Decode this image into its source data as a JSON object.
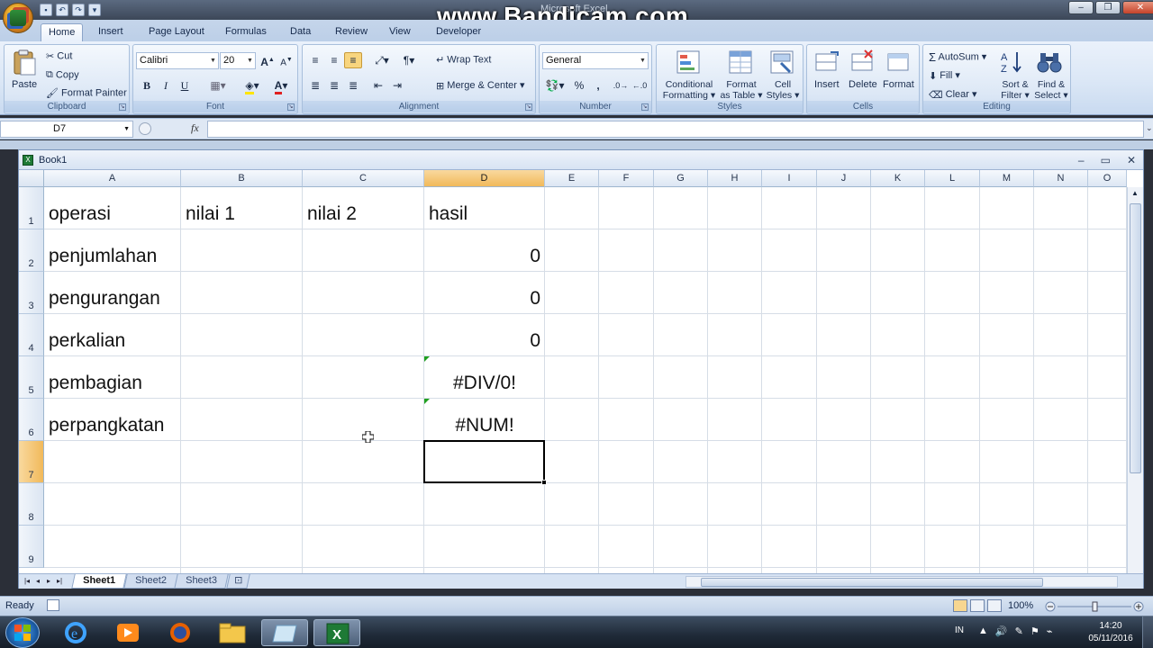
{
  "window": {
    "title": "Microsoft Excel",
    "watermark": "www.Bandicam.com"
  },
  "ribbon": {
    "tabs": [
      "Home",
      "Insert",
      "Page Layout",
      "Formulas",
      "Data",
      "Review",
      "View",
      "Developer"
    ],
    "active_tab": "Home",
    "clipboard": {
      "label": "Clipboard",
      "paste": "Paste",
      "cut": "Cut",
      "copy": "Copy",
      "format_painter": "Format Painter"
    },
    "font": {
      "label": "Font",
      "name": "Calibri",
      "size": "20",
      "bold": "B",
      "italic": "I",
      "underline": "U"
    },
    "alignment": {
      "label": "Alignment",
      "wrap_text": "Wrap Text",
      "merge_center": "Merge & Center"
    },
    "number": {
      "label": "Number",
      "format": "General",
      "percent": "%",
      "comma": ","
    },
    "styles": {
      "label": "Styles",
      "conditional": "Conditional",
      "conditional2": "Formatting",
      "format_table": "Format",
      "format_table2": "as Table",
      "cell_styles": "Cell",
      "cell_styles2": "Styles"
    },
    "cells": {
      "label": "Cells",
      "insert": "Insert",
      "delete": "Delete",
      "format": "Format"
    },
    "editing": {
      "label": "Editing",
      "autosum": "AutoSum",
      "fill": "Fill",
      "clear": "Clear",
      "sort": "Sort &",
      "sort2": "Filter",
      "find": "Find &",
      "find2": "Select"
    }
  },
  "formula_bar": {
    "name_box": "D7",
    "fx": "fx",
    "value": ""
  },
  "workbook": {
    "title": "Book1",
    "columns": [
      "A",
      "B",
      "C",
      "D",
      "E",
      "F",
      "G",
      "H",
      "I",
      "J",
      "K",
      "L",
      "M",
      "N",
      "O"
    ],
    "rows": [
      "1",
      "2",
      "3",
      "4",
      "5",
      "6",
      "7",
      "8",
      "9"
    ],
    "selected_col": "D",
    "selected_row": "7",
    "cells": {
      "A1": "operasi",
      "B1": "nilai 1",
      "C1": "nilai 2",
      "D1": "hasil",
      "A2": "penjumlahan",
      "D2": "0",
      "A3": "pengurangan",
      "D3": "0",
      "A4": "perkalian",
      "D4": "0",
      "A5": "pembagian",
      "D5": "#DIV/0!",
      "A6": "perpangkatan",
      "D6": "#NUM!"
    },
    "sheets": [
      "Sheet1",
      "Sheet2",
      "Sheet3"
    ],
    "active_sheet": "Sheet1"
  },
  "status": {
    "ready": "Ready",
    "zoom": "100%"
  },
  "taskbar": {
    "language": "IN",
    "time": "14:20",
    "date": "05/11/2016"
  },
  "colors": {
    "ribbon_bg": "#dbe7f6",
    "selected_header": "#f1b95a",
    "error_triangle": "#20a020"
  }
}
